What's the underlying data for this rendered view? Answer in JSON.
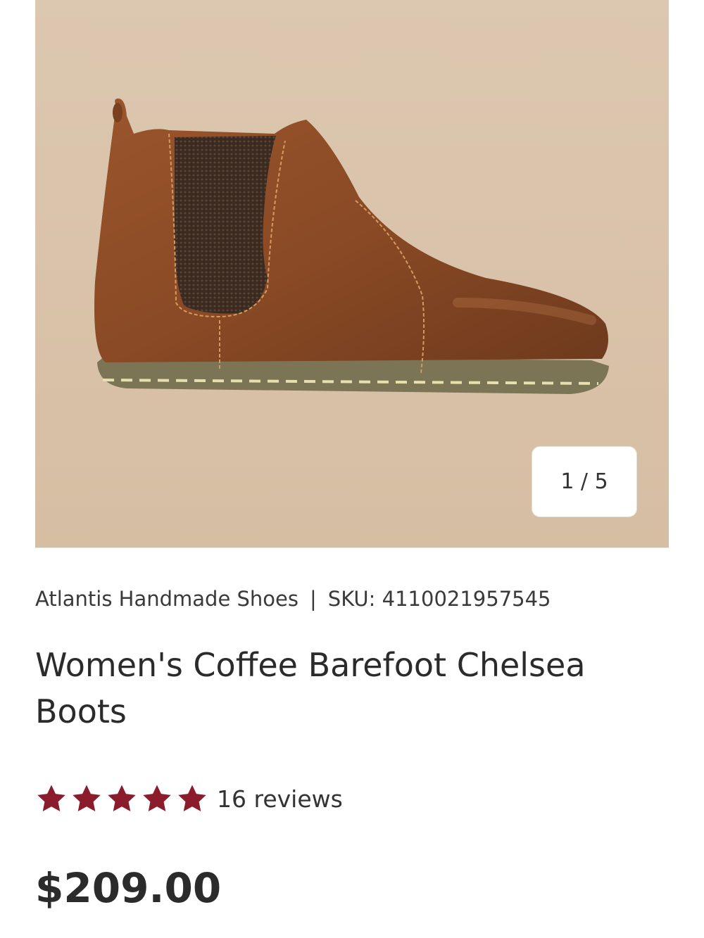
{
  "gallery": {
    "counter": "1 / 5",
    "image_alt": "Women's Coffee Barefoot Chelsea Boots"
  },
  "product": {
    "brand": "Atlantis Handmade Shoes",
    "separator": "|",
    "sku": "SKU: 4110021957545",
    "title": "Women's Coffee Barefoot Chelsea Boots",
    "rating": {
      "stars": 5,
      "max": 5,
      "reviews_label": "16 reviews"
    },
    "price": "$209.00"
  },
  "colors": {
    "star": "#8b1c2b",
    "background_photo": "#d9c3aa",
    "leather": "#8a4a25"
  },
  "icons": {
    "star": "star-icon"
  }
}
